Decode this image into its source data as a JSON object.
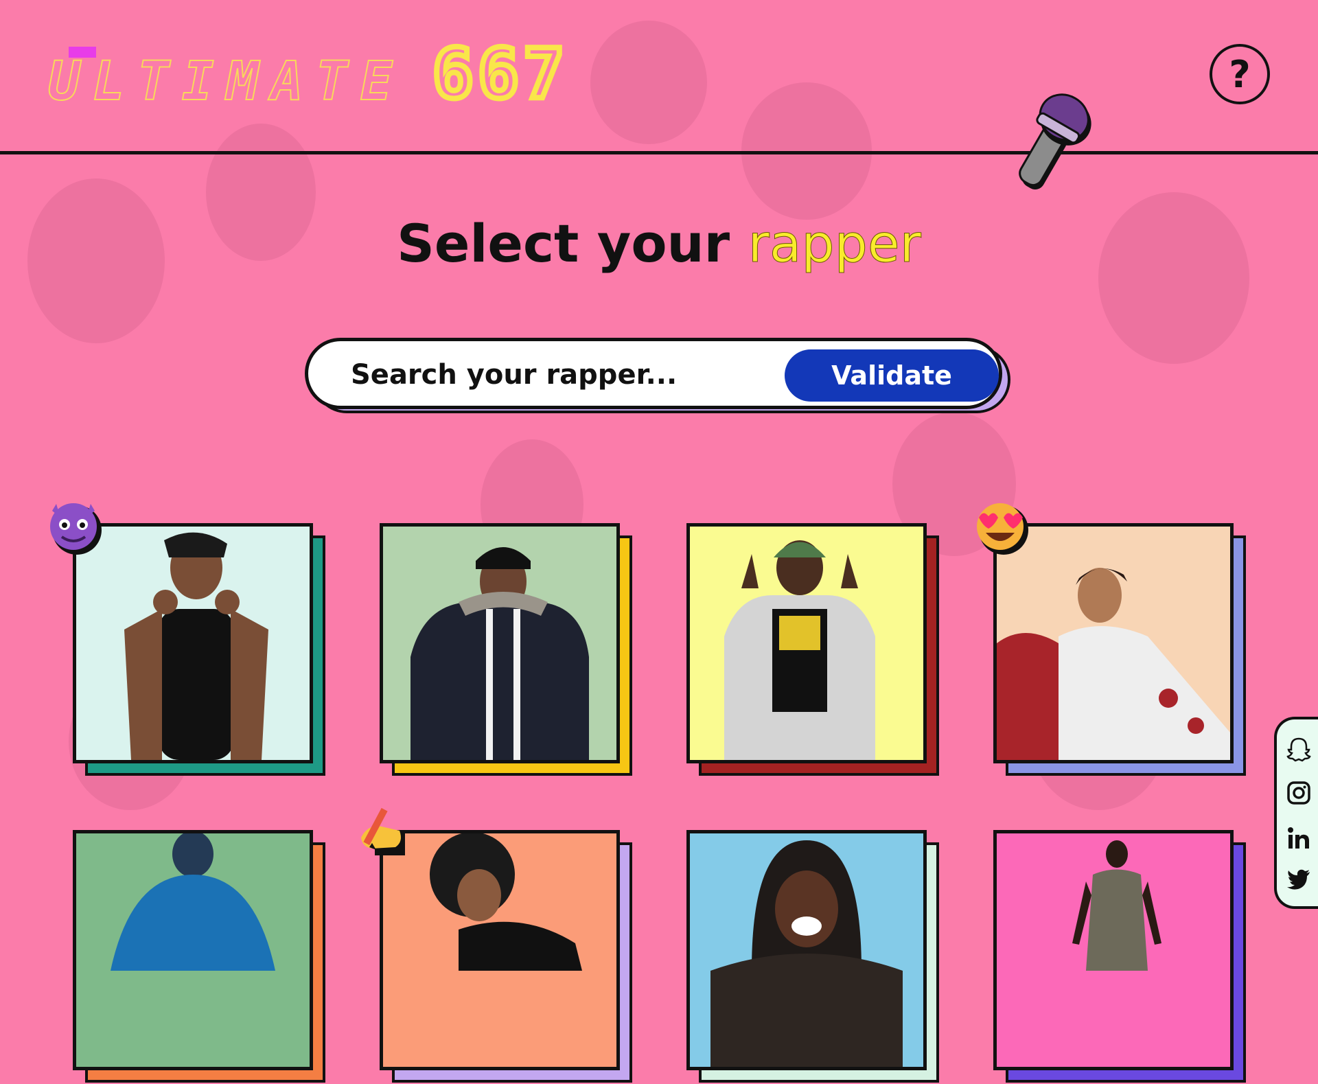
{
  "header": {
    "logo_word": "ltimate",
    "logo_initial": "U",
    "logo_number": "667",
    "help_label": "?"
  },
  "title": {
    "part1": "Select your",
    "part2": "rapper"
  },
  "search": {
    "placeholder": "Search your rapper...",
    "value": "",
    "button_label": "Validate"
  },
  "colors": {
    "background": "#fb7caa",
    "accent_yellow": "#f9ec2c",
    "button_blue": "#1338b8"
  },
  "cards": [
    {
      "bg": "#daf3ee",
      "shadow": "#1e9a86",
      "badge": "smiling-devil-emoji"
    },
    {
      "bg": "#b3d3ad",
      "shadow": "#f7c614",
      "badge": ""
    },
    {
      "bg": "#fafb91",
      "shadow": "#a42222",
      "badge": ""
    },
    {
      "bg": "#f8d5b5",
      "shadow": "#8a95e6",
      "badge": "heart-eyes-emoji"
    },
    {
      "bg": "#7fba8a",
      "shadow": "#f47e43",
      "badge": ""
    },
    {
      "bg": "#fb9c78",
      "shadow": "#c3a7f0",
      "badge": "writing-hand-emoji"
    },
    {
      "bg": "#84cbe8",
      "shadow": "#d5f1e2",
      "badge": ""
    },
    {
      "bg": "#fc69b8",
      "shadow": "#6a49e0",
      "badge": ""
    }
  ],
  "social": [
    "snapchat-icon",
    "instagram-icon",
    "linkedin-icon",
    "twitter-icon"
  ]
}
